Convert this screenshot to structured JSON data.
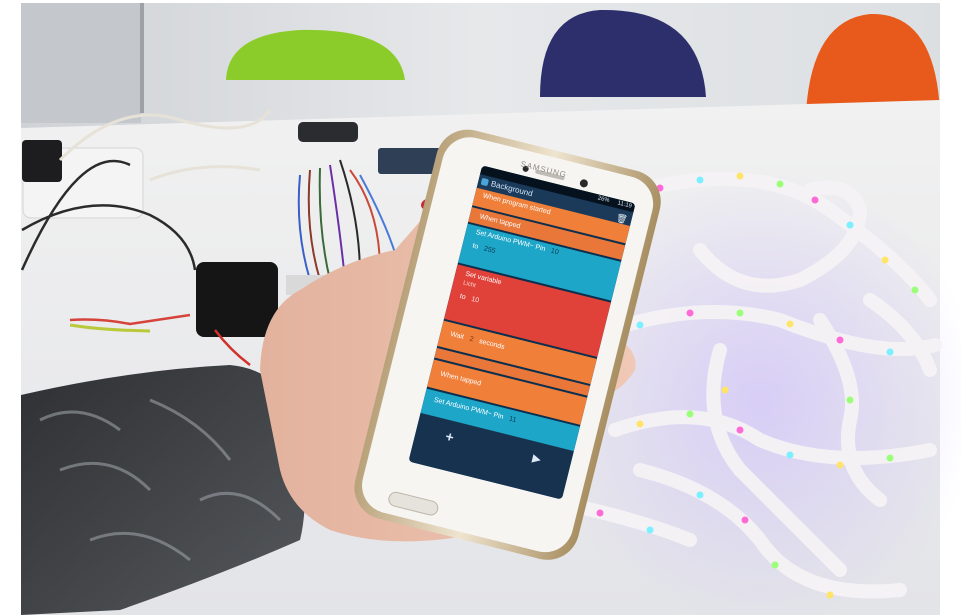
{
  "phone": {
    "brand": "SAMSUNG",
    "status_bar": {
      "battery": "26%",
      "time": "11:19"
    }
  },
  "app": {
    "title": "Background",
    "blocks": {
      "when_program_started": "When program started",
      "when_tapped_1": "When tapped",
      "set_pwm_1": {
        "label": "Set Arduino PWM~ Pin",
        "pin": "10",
        "to_label": "to",
        "value": "255"
      },
      "set_variable": {
        "label": "Set variable",
        "name": "Licht",
        "to_label": "to",
        "value": "10"
      },
      "wait": {
        "label": "Wait",
        "value": "2",
        "unit": "seconds"
      },
      "when_tapped_2": "When tapped",
      "set_pwm_2": {
        "label": "Set Arduino PWM~ Pin",
        "pin": "11"
      }
    },
    "toolbar": {
      "add_icon": "plus-icon",
      "play_icon": "play-icon"
    },
    "header": {
      "delete_icon": "trash-icon",
      "app_icon": "pocket-code-icon"
    }
  },
  "colors": {
    "block_orange": "#f07f3a",
    "block_blue": "#1ea6c8",
    "block_red": "#e0423a",
    "app_bar": "#1b3a5a",
    "bottom_bar": "#17324f"
  }
}
